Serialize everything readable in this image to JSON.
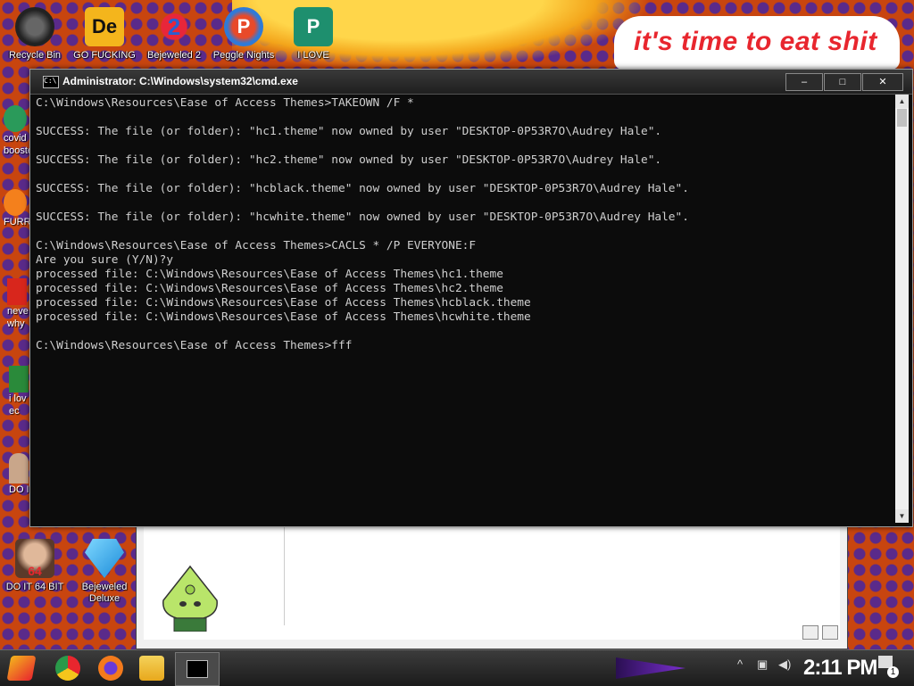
{
  "wallpaper": {
    "speech_text": "it's time to eat shit"
  },
  "desktop_icons": [
    {
      "label": "Recycle Bin",
      "icon": "recycle-bin-icon"
    },
    {
      "label": "GO FUCKING",
      "icon": "de-app-icon"
    },
    {
      "label": "Bejeweled 2",
      "icon": "bejeweled-2-icon"
    },
    {
      "label": "Peggle Nights",
      "icon": "peggle-icon"
    },
    {
      "label": "I LOVE",
      "icon": "publisher-icon"
    },
    {
      "label": "DO IT 64 BIT",
      "icon": "portrait-icon"
    },
    {
      "label": "Bejeweled Deluxe",
      "icon": "diamond-icon"
    }
  ],
  "partial_icons": [
    {
      "label": "covid\nbooste"
    },
    {
      "label": "FURR"
    },
    {
      "label": "neve\nwhy"
    },
    {
      "label": "i lov\nec"
    },
    {
      "label": "DO I"
    }
  ],
  "cmd": {
    "title": "Administrator: C:\\Windows\\system32\\cmd.exe",
    "buttons": {
      "minimize": "–",
      "maximize": "□",
      "close": "✕"
    },
    "lines": [
      "C:\\Windows\\Resources\\Ease of Access Themes>TAKEOWN /F *",
      "",
      "SUCCESS: The file (or folder): \"hc1.theme\" now owned by user \"DESKTOP-0P53R7O\\Audrey Hale\".",
      "",
      "SUCCESS: The file (or folder): \"hc2.theme\" now owned by user \"DESKTOP-0P53R7O\\Audrey Hale\".",
      "",
      "SUCCESS: The file (or folder): \"hcblack.theme\" now owned by user \"DESKTOP-0P53R7O\\Audrey Hale\".",
      "",
      "SUCCESS: The file (or folder): \"hcwhite.theme\" now owned by user \"DESKTOP-0P53R7O\\Audrey Hale\".",
      "",
      "C:\\Windows\\Resources\\Ease of Access Themes>CACLS * /P EVERYONE:F",
      "Are you sure (Y/N)?y",
      "processed file: C:\\Windows\\Resources\\Ease of Access Themes\\hc1.theme",
      "processed file: C:\\Windows\\Resources\\Ease of Access Themes\\hc2.theme",
      "processed file: C:\\Windows\\Resources\\Ease of Access Themes\\hcblack.theme",
      "processed file: C:\\Windows\\Resources\\Ease of Access Themes\\hcwhite.theme",
      "",
      "C:\\Windows\\Resources\\Ease of Access Themes>fff"
    ]
  },
  "taskbar": {
    "start_icon": "start-logo-icon",
    "pinned": [
      "chrome-icon",
      "firefox-icon",
      "file-explorer-icon",
      "cmd-icon"
    ],
    "clock": "2:11 PM",
    "notification_count": "1"
  }
}
